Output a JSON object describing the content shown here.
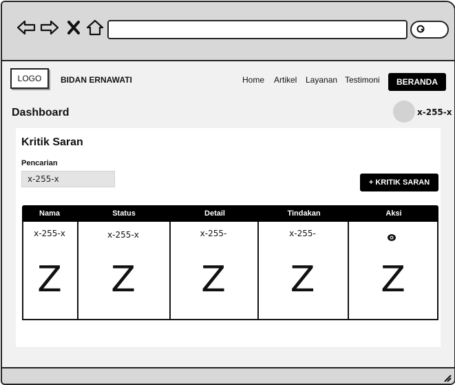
{
  "browser": {
    "back_icon": "arrow-left-icon",
    "forward_icon": "arrow-right-icon",
    "close_icon": "x-icon",
    "home_icon": "home-icon",
    "search_icon": "search-icon"
  },
  "header": {
    "logo": "LOGO",
    "brand": "BIDAN ERNAWATI",
    "menu": [
      "Home",
      "Artikel",
      "Layanan",
      "Testimoni"
    ],
    "cta": "BERANDA"
  },
  "page": {
    "title": "Dashboard",
    "user": "x-255-x"
  },
  "section": {
    "title": "Kritik Saran",
    "search_label": "Pencarian",
    "search_value": "x-255-x",
    "add_button": "+ KRITIK SARAN"
  },
  "table": {
    "headers": [
      "Nama",
      "Status",
      "Detail",
      "Tindakan",
      "Aksi"
    ],
    "row": [
      "x-255-x",
      "x-255-x",
      "x-255-",
      "x-255-"
    ],
    "action_icon": "eye-icon",
    "placeholder": [
      "Z",
      "Z",
      "Z",
      "Z",
      "Z"
    ]
  },
  "colors": {
    "button_bg": "#000000",
    "chrome_bg": "#d8d8d8",
    "page_bg": "#f1f1f1"
  }
}
